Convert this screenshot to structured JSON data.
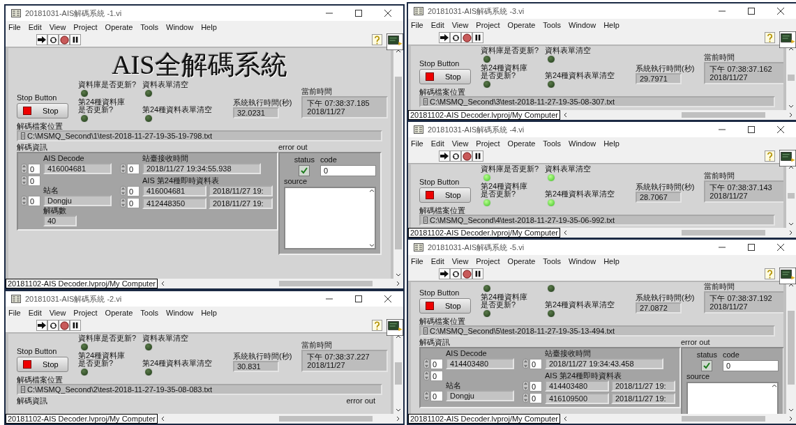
{
  "windows": [
    {
      "title": "20181031-AIS解碼系統 -1.vi",
      "menu": [
        "File",
        "Edit",
        "View",
        "Project",
        "Operate",
        "Tools",
        "Window",
        "Help"
      ],
      "heading": "AIS全解碼系統",
      "stop": {
        "caption": "Stop Button",
        "label": "Stop"
      },
      "leds": [
        {
          "label": [
            "資料庫是否更新?"
          ],
          "on": false
        },
        {
          "label": [
            "資料表單清空"
          ],
          "on": false
        },
        {
          "label": [
            "第24種資料庫",
            "是否更新?"
          ],
          "on": false
        },
        {
          "label": [
            "第24種資料表單清空"
          ],
          "on": false
        }
      ],
      "runtime": {
        "label": "系統執行時間(秒)",
        "value": "32.0231"
      },
      "clock": {
        "label": "當前時間",
        "lines": [
          "下午 07:38:37.185",
          "2018/11/27"
        ]
      },
      "path": {
        "label": "解碼檔案位置",
        "value": "C:\\MSMQ_Second\\1\\test-2018-11-27-19-35-19-798.txt"
      },
      "decode": {
        "label": "解碼資訊",
        "ais": {
          "label": "AIS Decode",
          "indexes": [
            "0",
            "0"
          ],
          "value": "416004681"
        },
        "station_time": {
          "label": "站臺接收時間",
          "index": "0",
          "value": "2018/11/27 19:34:55.938"
        },
        "station": {
          "label": "站名",
          "index": "0",
          "value": "Dongju"
        },
        "table": {
          "label": "AIS 第24種即時資料表",
          "indexes": [
            "0",
            "0"
          ],
          "rows": [
            [
              "416004681",
              "2018/11/27 19:"
            ],
            [
              "412448350",
              "2018/11/27 19:"
            ]
          ]
        },
        "count": {
          "label": "解碼數",
          "value": "40"
        }
      },
      "error": {
        "label": "error out",
        "status_label": "status",
        "status_ok": true,
        "code_label": "code",
        "code": "0",
        "source_label": "source"
      },
      "project": "20181102-AIS Decoder.lvproj/My Computer"
    },
    {
      "title": "20181031-AIS解碼系統 -2.vi",
      "menu": [
        "File",
        "Edit",
        "View",
        "Project",
        "Operate",
        "Tools",
        "Window",
        "Help"
      ],
      "stop": {
        "caption": "Stop Button",
        "label": "Stop"
      },
      "leds": [
        {
          "label": [
            "資料庫是否更新?"
          ],
          "on": false
        },
        {
          "label": [
            "資料表單清空"
          ],
          "on": false
        },
        {
          "label": [
            "第24種資料庫",
            "是否更新?"
          ],
          "on": false
        },
        {
          "label": [
            "第24種資料表單清空"
          ],
          "on": false
        }
      ],
      "runtime": {
        "label": "系統執行時間(秒)",
        "value": "30.831"
      },
      "clock": {
        "label": "當前時間",
        "lines": [
          "下午 07:38:37.227",
          "2018/11/27"
        ]
      },
      "path": {
        "label": "解碼檔案位置",
        "value": "C:\\MSMQ_Second\\2\\test-2018-11-27-19-35-08-083.txt"
      },
      "decode": {
        "label": "解碼資訊"
      },
      "error": {
        "label": "error out"
      },
      "project": "20181102-AIS Decoder.lvproj/My Computer"
    },
    {
      "title": "20181031-AIS解碼系統 -3.vi",
      "menu": [
        "File",
        "Edit",
        "View",
        "Project",
        "Operate",
        "Tools",
        "Window",
        "Help"
      ],
      "stop": {
        "caption": "Stop Button",
        "label": "Stop"
      },
      "leds": [
        {
          "label": [
            "資料庫是否更新?"
          ],
          "on": false
        },
        {
          "label": [
            "資料表單清空"
          ],
          "on": false
        },
        {
          "label": [
            "第24種資料庫",
            "是否更新?"
          ],
          "on": false
        },
        {
          "label": [
            "第24種資料表單清空"
          ],
          "on": false
        }
      ],
      "runtime": {
        "label": "系統執行時間(秒)",
        "value": "29.7971"
      },
      "clock": {
        "label": "當前時間",
        "lines": [
          "下午 07:38:37.162",
          "2018/11/27"
        ]
      },
      "path": {
        "label": "解碼檔案位置",
        "value": "C:\\MSMQ_Second\\3\\test-2018-11-27-19-35-08-307.txt"
      },
      "project": "20181102-AIS Decoder.lvproj/My Computer"
    },
    {
      "title": "20181031-AIS解碼系統 -4.vi",
      "menu": [
        "File",
        "Edit",
        "View",
        "Project",
        "Operate",
        "Tools",
        "Window",
        "Help"
      ],
      "stop": {
        "caption": "Stop Button",
        "label": "Stop"
      },
      "leds": [
        {
          "label": [
            "資料庫是否更新?"
          ],
          "on": true
        },
        {
          "label": [
            "資料表單清空"
          ],
          "on": true
        },
        {
          "label": [
            "第24種資料庫",
            "是否更新?"
          ],
          "on": true
        },
        {
          "label": [
            "第24種資料表單清空"
          ],
          "on": true
        }
      ],
      "runtime": {
        "label": "系統執行時間(秒)",
        "value": "28.7067"
      },
      "clock": {
        "label": "當前時間",
        "lines": [
          "下午 07:38:37.143",
          "2018/11/27"
        ]
      },
      "path": {
        "label": "解碼檔案位置",
        "value": "C:\\MSMQ_Second\\4\\test-2018-11-27-19-35-06-992.txt"
      },
      "project": "20181102-AIS Decoder.lvproj/My Computer"
    },
    {
      "title": "20181031-AIS解碼系統 -5.vi",
      "menu": [
        "File",
        "Edit",
        "View",
        "Project",
        "Operate",
        "Tools",
        "Window",
        "Help"
      ],
      "stop": {
        "caption": "Stop Button",
        "label": "Stop"
      },
      "leds": [
        {
          "on": false
        },
        {
          "on": false
        },
        {
          "label": [
            "第24種資料庫",
            "是否更新?"
          ],
          "on": false
        },
        {
          "label": [
            "第24種資料表單清空"
          ],
          "on": false
        }
      ],
      "runtime": {
        "label": "系統執行時間(秒)",
        "value": "27.0872"
      },
      "clock": {
        "label": "當前時間",
        "lines": [
          "下午 07:38:37.192",
          "2018/11/27"
        ]
      },
      "path": {
        "label": "解碼檔案位置",
        "value": "C:\\MSMQ_Second\\5\\test-2018-11-27-19-35-13-494.txt"
      },
      "decode": {
        "label": "解碼資訊",
        "ais": {
          "label": "AIS Decode",
          "indexes": [
            "0",
            "0"
          ],
          "value": "414403480"
        },
        "station_time": {
          "label": "站臺接收時間",
          "index": "0",
          "value": "2018/11/27 19:34:43.458"
        },
        "station": {
          "label": "站名",
          "index": "0",
          "value": "Dongju"
        },
        "table": {
          "label": "AIS 第24種即時資料表",
          "indexes": [
            "0",
            "0"
          ],
          "rows": [
            [
              "414403480",
              "2018/11/27 19:"
            ],
            [
              "416109500",
              "2018/11/27 19:"
            ]
          ]
        }
      },
      "error": {
        "label": "error out",
        "status_label": "status",
        "status_ok": true,
        "code_label": "code",
        "code": "0",
        "source_label": "source"
      },
      "project": "20181102-AIS Decoder.lvproj/My Computer"
    }
  ]
}
